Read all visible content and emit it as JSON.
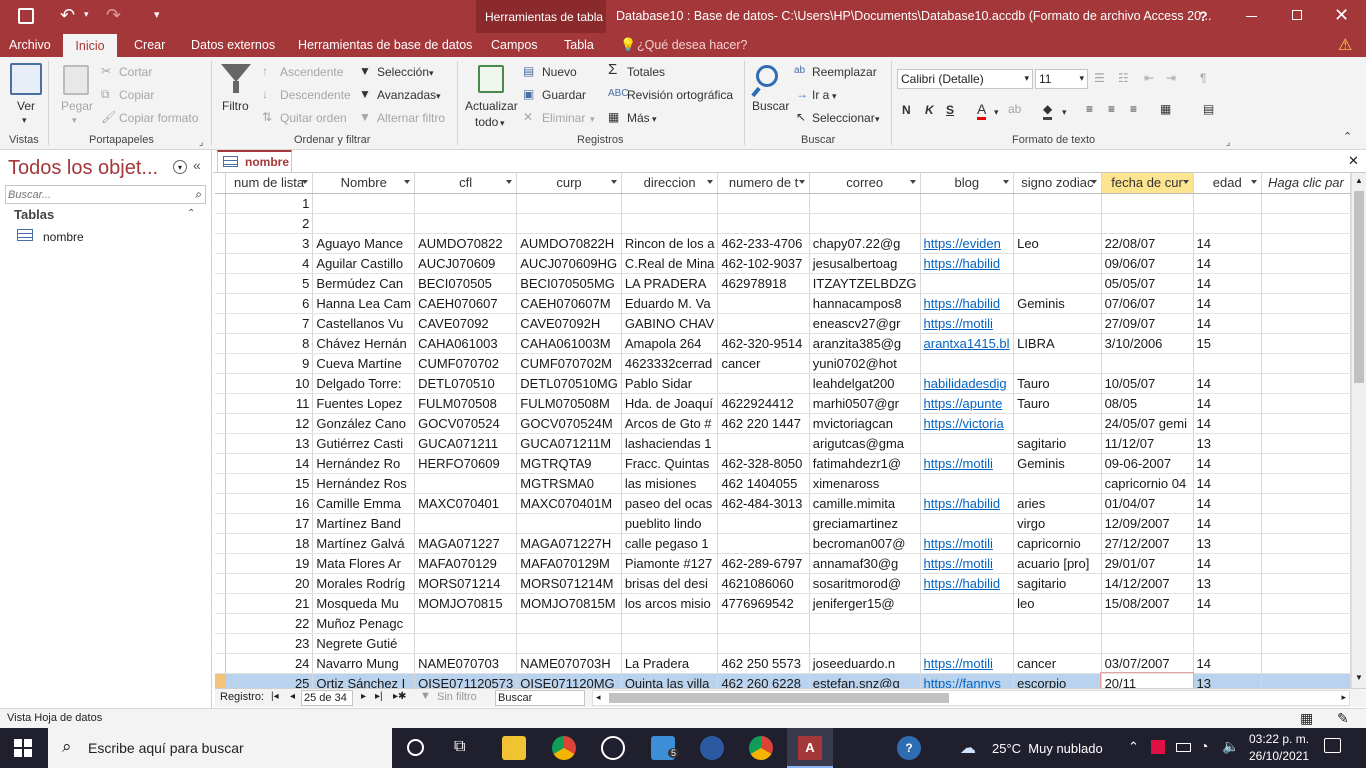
{
  "titlebar": {
    "context_tab": "Herramientas de tabla",
    "title": "Database10 : Base de datos- C:\\Users\\HP\\Documents\\Database10.accdb (Formato de archivo Access 20...",
    "help": "?"
  },
  "tabs": [
    "Archivo",
    "Inicio",
    "Crear",
    "Datos externos",
    "Herramientas de base de datos",
    "Campos",
    "Tabla"
  ],
  "tell_me": "¿Qué desea hacer?",
  "ribbon": {
    "vistas": {
      "ver": "Ver",
      "group": "Vistas"
    },
    "portapapeles": {
      "pegar": "Pegar",
      "cortar": "Cortar",
      "copiar": "Copiar",
      "copiar_formato": "Copiar formato",
      "group": "Portapapeles"
    },
    "ordenar": {
      "filtro": "Filtro",
      "ascendente": "Ascendente",
      "descendente": "Descendente",
      "quitar_orden": "Quitar orden",
      "seleccion": "Selección",
      "avanzadas": "Avanzadas",
      "alternar": "Alternar filtro",
      "group": "Ordenar y filtrar"
    },
    "registros": {
      "actualizar": "Actualizar",
      "todo": "todo",
      "nuevo": "Nuevo",
      "guardar": "Guardar",
      "eliminar": "Eliminar",
      "totales": "Totales",
      "revision": "Revisión ortográfica",
      "mas": "Más",
      "group": "Registros"
    },
    "buscar": {
      "buscar": "Buscar",
      "reemplazar": "Reemplazar",
      "ir_a": "Ir a",
      "seleccionar": "Seleccionar",
      "group": "Buscar"
    },
    "formato": {
      "font": "Calibri (Detalle)",
      "size": "11",
      "bold": "N",
      "italic": "K",
      "underline": "S",
      "font_color": "A",
      "group": "Formato de texto"
    }
  },
  "nav": {
    "title": "Todos los objet...",
    "search_placeholder": "Buscar...",
    "section": "Tablas",
    "item": "nombre"
  },
  "doc_tab": "nombre",
  "columns": [
    "num de lista",
    "Nombre",
    "cfl",
    "curp",
    "direccion",
    "numero de t",
    "correo",
    "blog",
    "signo zodiac",
    "fecha de cur",
    "edad",
    "Haga clic par"
  ],
  "rows": [
    [
      "1",
      "",
      "",
      "",
      "",
      "",
      "",
      "",
      "",
      "",
      ""
    ],
    [
      "2",
      "",
      "",
      "",
      "",
      "",
      "",
      "",
      "",
      "",
      ""
    ],
    [
      "3",
      "Aguayo Mance",
      "AUMDO70822",
      "AUMDO70822H",
      "Rincon de los a",
      "462-233-4706",
      "chapy07.22@g",
      "https://eviden",
      "Leo",
      "22/08/07",
      "14"
    ],
    [
      "4",
      "Aguilar Castillo",
      "AUCJ070609",
      "AUCJ070609HG",
      "C.Real de Mina",
      "462-102-9037",
      "jesusalbertoag",
      "https://habilid",
      "",
      "09/06/07",
      "14"
    ],
    [
      "5",
      "Bermúdez Can",
      "BECI070505",
      "BECI070505MG",
      "LA PRADERA",
      "462978918",
      "ITZAYTZELBDZG",
      "",
      "",
      "05/05/07",
      "14"
    ],
    [
      "6",
      "Hanna Lea Cam",
      "CAEH070607",
      "CAEH070607M",
      "Eduardo M. Va",
      "",
      "hannacampos8",
      "https://habilid",
      "Geminis",
      "07/06/07",
      "14"
    ],
    [
      "7",
      "Castellanos Vu",
      "CAVE07092",
      "CAVE07092H",
      "GABINO CHAV",
      "",
      "eneascv27@gr",
      "https://motili",
      "",
      "27/09/07",
      "14"
    ],
    [
      "8",
      "Chávez Hernán",
      "CAHA061003",
      "CAHA061003M",
      "Amapola 264",
      "462-320-9514",
      "aranzita385@g",
      "arantxa1415.bl",
      "LIBRA",
      "3/10/2006",
      "15"
    ],
    [
      "9",
      "Cueva Martíne",
      "CUMF070702",
      "CUMF070702M",
      "4623332cerrad",
      "cancer",
      "yuni0702@hot",
      "",
      "",
      "",
      ""
    ],
    [
      "10",
      "Delgado Torre:",
      "DETL070510",
      "DETL070510MG",
      "Pablo Sidar",
      "",
      "leahdelgat200",
      "habilidadesdig",
      "Tauro",
      "10/05/07",
      "14"
    ],
    [
      "11",
      "Fuentes Lopez",
      "FULM070508",
      "FULM070508M",
      "Hda. de Joaquí",
      "4622924412",
      "marhi0507@gr",
      "https://apunte",
      "Tauro",
      "08/05",
      "14"
    ],
    [
      "12",
      "González Cano",
      "GOCV070524",
      "GOCV070524M",
      "Arcos de Gto #",
      "462 220 1447",
      "mvictoriagcan",
      "https://victoria",
      "",
      "24/05/07 gemi",
      "14"
    ],
    [
      "13",
      "Gutiérrez Casti",
      "GUCA071211",
      "GUCA071211M",
      "lashaciendas 1",
      "",
      "arigutcas@gma",
      "",
      "sagitario",
      "11/12/07",
      "13"
    ],
    [
      "14",
      "Hernández Ro",
      "HERFO70609",
      "MGTRQTA9",
      "Fracc. Quintas",
      "462-328-8050",
      "fatimahdezr1@",
      "https://motili",
      "Geminis",
      "09-06-2007",
      "14"
    ],
    [
      "15",
      "Hernández Ros",
      "",
      "MGTRSMA0",
      "las misiones",
      "462 1404055",
      "ximenaross",
      "",
      "",
      "capricornio 04",
      "14"
    ],
    [
      "16",
      "Camille Emma",
      "MAXC070401",
      "MAXC070401M",
      "paseo del ocas",
      "462-484-3013",
      "camille.mimita",
      "https://habilid",
      "aries",
      "01/04/07",
      "14"
    ],
    [
      "17",
      "Martínez Band",
      "",
      "",
      "pueblito lindo",
      "",
      "greciamartinez",
      "",
      "virgo",
      "12/09/2007",
      "14"
    ],
    [
      "18",
      "Martínez Galvá",
      "MAGA071227",
      "MAGA071227H",
      "calle pegaso 1",
      "",
      "becroman007@",
      "https://motili",
      "capricornio",
      "27/12/2007",
      "13"
    ],
    [
      "19",
      "Mata Flores Ar",
      "MAFA070129",
      "MAFA070129M",
      "Piamonte #127",
      "462-289-6797",
      "annamaf30@g",
      "https://motili",
      "acuario [pro]",
      "29/01/07",
      "14"
    ],
    [
      "20",
      "Morales Rodríg",
      "MORS071214",
      "MORS071214M",
      "brisas del desi",
      "4621086060",
      "sosaritmorod@",
      "https://habilid",
      "sagitario",
      "14/12/2007",
      "13"
    ],
    [
      "21",
      "Mosqueda Mu",
      "MOMJO70815",
      "MOMJO70815M",
      "los arcos misio",
      "4776969542",
      "jeniferger15@",
      "",
      "leo",
      "15/08/2007",
      "14"
    ],
    [
      "22",
      "Muñoz Penagc",
      "",
      "",
      "",
      "",
      "",
      "",
      "",
      "",
      ""
    ],
    [
      "23",
      "Negrete Gutié",
      "",
      "",
      "",
      "",
      "",
      "",
      "",
      "",
      ""
    ],
    [
      "24",
      "Navarro Mung",
      "NAME070703",
      "NAME070703H",
      "La Pradera",
      "462 250 5573",
      "joseeduardo.n",
      "https://motili",
      "cancer",
      "03/07/2007",
      "14"
    ],
    [
      "25",
      "Ortiz Sánchez I",
      "OISE071120573",
      "OISE071120MG",
      "Quinta las villa",
      "462 260 6228",
      "estefan.snz@g",
      "https://fannys",
      "escorpio",
      "20/11",
      "13"
    ]
  ],
  "link_col": 7,
  "current_row": 24,
  "record_nav": {
    "label": "Registro:",
    "current": "25 de 34",
    "no_filter": "Sin filtro",
    "search": "Buscar"
  },
  "status": "Vista Hoja de datos",
  "taskbar": {
    "search": "Escribe aquí para buscar",
    "weather": "25°C  Muy nublado",
    "time": "03:22 p. m.",
    "date": "26/10/2021",
    "badge": "5"
  },
  "colors": {
    "accent": "#a4373a",
    "selected_col": "#fde490",
    "current_row": "#b9d3ee",
    "link": "#0563c1"
  }
}
